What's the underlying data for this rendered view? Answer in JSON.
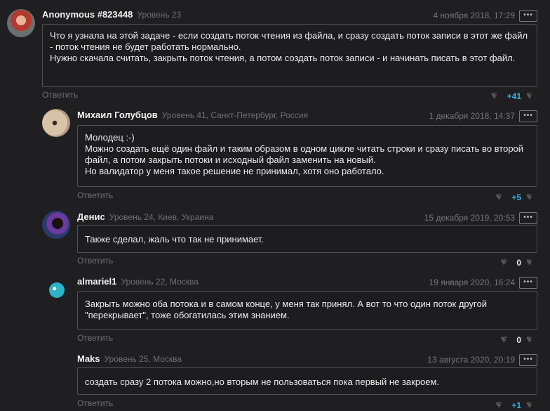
{
  "comments": [
    {
      "author": "Anonymous #823448",
      "meta": "Уровень 23",
      "date": "4 ноября 2018, 17:29",
      "text": [
        "Что я узнала на этой задаче - если создать поток чтения из файла, и сразу создать поток записи в этот же файл - поток чтения не будет работать нормально.",
        "Нужно скачала считать, закрыть поток чтения, а потом создать поток записи - и начинать писать в этот файл."
      ],
      "reply": "Ответить",
      "votes": "+41",
      "avatar_color": "#b33a2e"
    },
    {
      "author": "Михаил Голубцов",
      "meta": "Уровень 41, Санкт-Петербург, Россия",
      "date": "1 декабря 2018, 14:37",
      "text": [
        "Молодец :-)",
        "Можно создать ещё один файл и таким образом в одном цикле читать строки и сразу писать во второй файл, а потом закрыть потоки и исходный файл заменить на новый.",
        "Но валидатор у меня такое решение не принимал, хотя оно работало."
      ],
      "reply": "Ответить",
      "votes": "+5",
      "avatar_color": "#d9c3a8"
    },
    {
      "author": "Денис",
      "meta": "Уровень 24, Киев, Украина",
      "date": "15 декабря 2019, 20:53",
      "text": [
        "Также сделал, жаль что так не принимает."
      ],
      "reply": "Ответить",
      "votes": "0",
      "avatar_color": "#3a2a5a"
    },
    {
      "author": "almariel1",
      "meta": "Уровень 22, Москва",
      "date": "19 января 2020, 16:24",
      "text": [
        "Закрыть можно оба потока и в самом конце, у меня так принял. А вот то что один поток другой \"перекрывает\", тоже обогатилась этим знанием."
      ],
      "reply": "Ответить",
      "votes": "0",
      "avatar_color": "#2bb3c9"
    },
    {
      "author": "Maks",
      "meta": "Уровень 25, Москва",
      "date": "13 августа 2020, 20:19",
      "text": [
        "создать сразу 2 потока можно,но вторым не пользоваться пока первый не закроем."
      ],
      "reply": "Ответить",
      "votes": "+1"
    }
  ],
  "more_label": "•••",
  "icons": {
    "dislike": "heart-minus-icon",
    "like": "heart-plus-icon"
  }
}
